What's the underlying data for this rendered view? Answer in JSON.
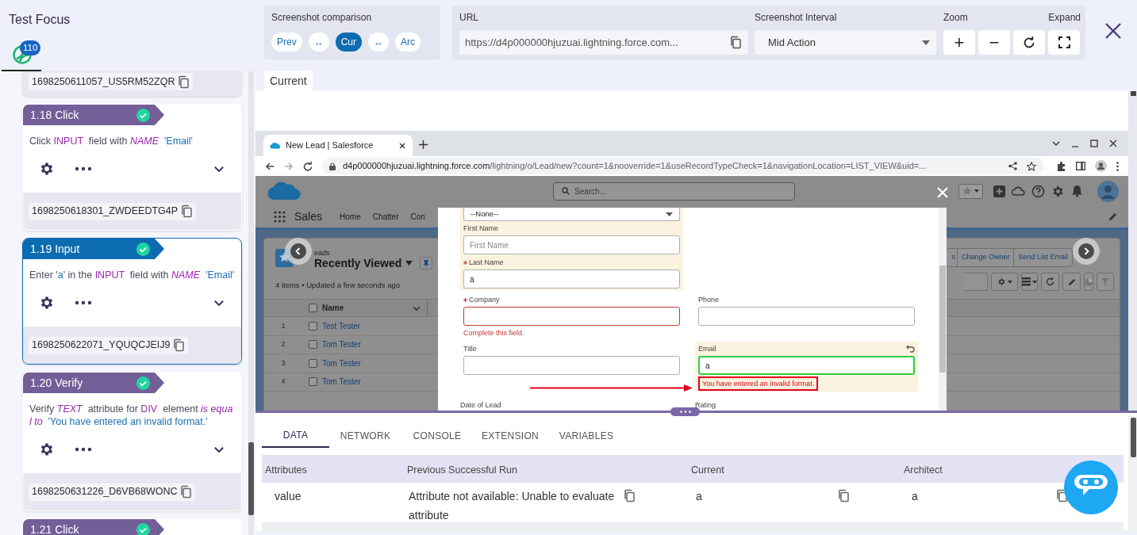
{
  "sidebar": {
    "title": "Test Focus",
    "badge": "110",
    "steps": [
      {
        "kind": "tail",
        "selected": false,
        "id": "1698250611057_US5RM52ZQR"
      },
      {
        "kind": "full",
        "title": "1.18 Click",
        "passed": true,
        "selected": false,
        "description": [
          {
            "kind": "plain",
            "text": "Click "
          },
          {
            "kind": "keyword",
            "text": "INPUT"
          },
          {
            "kind": "plain",
            "text": "  field with "
          },
          {
            "kind": "attr",
            "text": "NAME"
          },
          {
            "kind": "value",
            "text": "  'Email'"
          }
        ],
        "id": "1698250618301_ZWDEEDTG4P"
      },
      {
        "kind": "full",
        "title": "1.19 Input",
        "passed": true,
        "selected": true,
        "description": [
          {
            "kind": "plain",
            "text": "Enter "
          },
          {
            "kind": "value",
            "text": "'a'"
          },
          {
            "kind": "plain",
            "text": " in the "
          },
          {
            "kind": "keyword",
            "text": "INPUT"
          },
          {
            "kind": "plain",
            "text": "  field with "
          },
          {
            "kind": "attr",
            "text": "NAME"
          },
          {
            "kind": "value",
            "text": "  'Email'"
          }
        ],
        "id": "1698250622071_YQUQCJEIJ9"
      },
      {
        "kind": "full",
        "title": "1.20 Verify",
        "passed": true,
        "selected": false,
        "description": [
          {
            "kind": "plain",
            "text": "Verify "
          },
          {
            "kind": "attr",
            "text": "TEXT"
          },
          {
            "kind": "plain",
            "text": "  attribute for "
          },
          {
            "kind": "keyword",
            "text": "DIV"
          },
          {
            "kind": "plain",
            "text": "  element "
          },
          {
            "kind": "attr",
            "text": "is equal to"
          },
          {
            "kind": "value",
            "text": "  'You have entered an invalid format.'"
          }
        ],
        "id": "1698250631226_D6VB68WONC"
      },
      {
        "kind": "head",
        "title": "1.21 Click",
        "passed": true,
        "selected": false
      }
    ]
  },
  "toolbar": {
    "comparison": {
      "label": "Screenshot comparison",
      "buttons": [
        {
          "label": "Prev",
          "selected": false
        },
        {
          "label": "↔",
          "selected": false
        },
        {
          "label": "Cur",
          "selected": true
        },
        {
          "label": "↔",
          "selected": false
        },
        {
          "label": "Arc",
          "selected": false
        }
      ]
    },
    "url": {
      "label": "URL",
      "value": "https://d4p000000hjuzuai.lightning.force.com..."
    },
    "interval": {
      "label": "Screenshot Interval",
      "value": "Mid Action"
    },
    "zoom": {
      "label": "Zoom",
      "buttons": [
        "+",
        "−"
      ]
    },
    "expand": {
      "label": "Expand"
    }
  },
  "view_tabs": [
    {
      "label": "Current",
      "selected": true
    }
  ],
  "browser": {
    "tab_title": "New Lead | Salesforce",
    "url_host": "d4p000000hjuzuai.lightning.force.com",
    "url_path": "/lightning/o/Lead/new?count=1&nooverride=1&useRecordTypeCheck=1&navigationLocation=LIST_VIEW&uid=...",
    "search_placeholder": "Search...",
    "app_name": "Sales",
    "nav": [
      "Home",
      "Chatter",
      "Con"
    ],
    "list": {
      "object": "eads",
      "view": "Recently Viewed",
      "meta": "4 items • Updated a few seconds ago",
      "column": "Name",
      "all_checked": false,
      "rows": [
        {
          "number": "1",
          "name": "Test Tester",
          "checked": false
        },
        {
          "number": "2",
          "name": "Tom Tester",
          "checked": false
        },
        {
          "number": "3",
          "name": "Tom Tester",
          "checked": false
        },
        {
          "number": "4",
          "name": "Tom Tester",
          "checked": false
        }
      ]
    },
    "actions": [
      "s",
      "Change Owner",
      "Send List Email"
    ],
    "form": {
      "select": "--None--",
      "top_highlighted": true,
      "top_fields": [
        {
          "kind": "input",
          "label": "First Name",
          "placeholder": "First Name",
          "required": false,
          "invalid": false,
          "focused": false
        },
        {
          "kind": "input",
          "label": "Last Name",
          "value": "a",
          "required": true,
          "invalid": false,
          "focused": false
        }
      ],
      "rows": [
        [
          {
            "kind": "input",
            "label": "Company",
            "required": true,
            "invalid": true,
            "focused": false,
            "error": "Complete this field.",
            "annotated": false,
            "highlighted": false
          },
          {
            "kind": "input",
            "label": "Phone",
            "required": false,
            "invalid": false,
            "focused": false,
            "highlighted": false
          }
        ],
        [
          {
            "kind": "input",
            "label": "Title",
            "required": false,
            "invalid": false,
            "focused": false,
            "highlighted": false
          },
          {
            "kind": "input",
            "label": "Email",
            "value": "a",
            "required": false,
            "focused": true,
            "undo": true,
            "error": "You have entered an invalid format.",
            "annotated": true,
            "highlighted": true
          }
        ],
        [
          {
            "kind": "label",
            "label": "Date of Lead"
          },
          {
            "kind": "label",
            "label": "Rating"
          }
        ]
      ]
    }
  },
  "details": {
    "tabs": [
      {
        "label": "DATA",
        "selected": true
      },
      {
        "label": "NETWORK",
        "selected": false
      },
      {
        "label": "CONSOLE",
        "selected": false
      },
      {
        "label": "EXTENSION",
        "selected": false
      },
      {
        "label": "VARIABLES",
        "selected": false
      }
    ],
    "table": {
      "columns": [
        "Attributes",
        "Previous Successful Run",
        "Current",
        "Architect"
      ],
      "rows": [
        {
          "cells": [
            "value",
            "Attribute not available: Unable to evaluate attribute",
            "a",
            "a"
          ]
        }
      ]
    }
  }
}
